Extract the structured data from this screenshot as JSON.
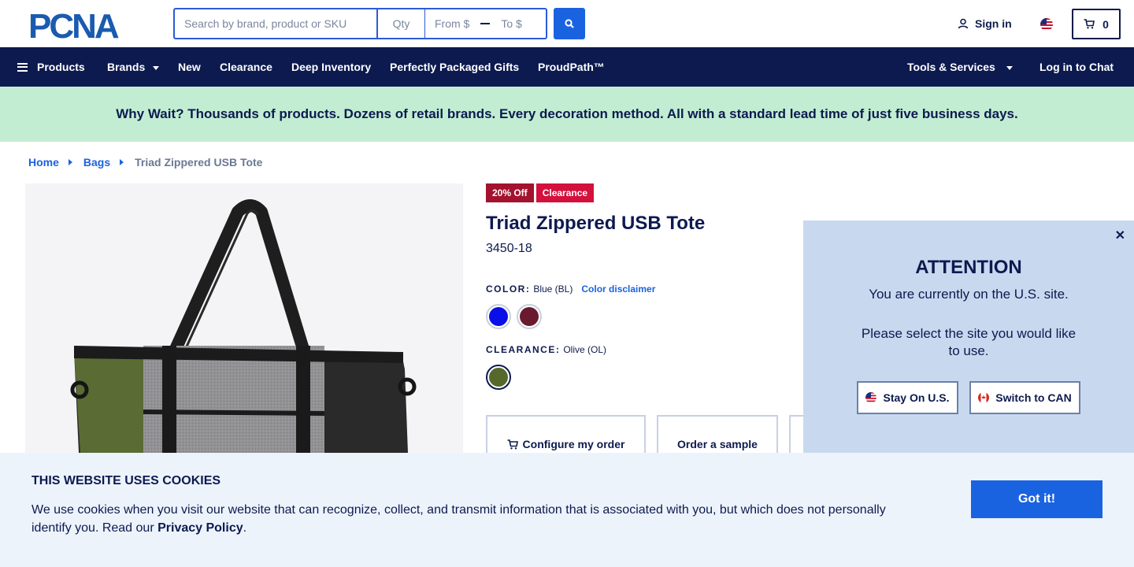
{
  "header": {
    "logo_text": "PCNA",
    "search": {
      "placeholder": "Search by brand, product or SKU",
      "qty_placeholder": "Qty",
      "from_placeholder": "From $",
      "to_placeholder": "To $"
    },
    "sign_in": "Sign in",
    "cart_count": "0"
  },
  "nav": {
    "items": [
      "Products",
      "Brands",
      "New",
      "Clearance",
      "Deep Inventory",
      "Perfectly Packaged Gifts",
      "ProudPath™"
    ],
    "tools": "Tools & Services",
    "chat": "Log in to Chat"
  },
  "promo": "Why Wait? Thousands of products. Dozens of retail brands. Every decoration method. All with a standard lead time of just five business days.",
  "breadcrumb": [
    "Home",
    "Bags",
    "Triad Zippered USB Tote"
  ],
  "product": {
    "badges": [
      "20% Off",
      "Clearance"
    ],
    "title": "Triad Zippered USB Tote",
    "sku": "3450-18",
    "color_label": "COLOR:",
    "color_value": "Blue (BL)",
    "color_disclaimer": "Color disclaimer",
    "colors": [
      "#0a0fe8",
      "#6a1a2e"
    ],
    "clearance_label": "CLEARANCE:",
    "clearance_value": "Olive (OL)",
    "clearance_colors": [
      "#56682b"
    ],
    "actions": [
      "Configure my order",
      "Order a sample"
    ]
  },
  "attention": {
    "title": "ATTENTION",
    "text1": "You are currently on the U.S. site.",
    "text2": "Please select the site you would like to use.",
    "stay": "Stay On U.S.",
    "switch": "Switch to CAN"
  },
  "cookie": {
    "title": "THIS WEBSITE USES COOKIES",
    "text": "We use cookies when you visit our website that can recognize, collect, and transmit information that is associated with you, but which does not personally identify you. Read our ",
    "link": "Privacy Policy",
    "end": ".",
    "button": "Got it!"
  }
}
